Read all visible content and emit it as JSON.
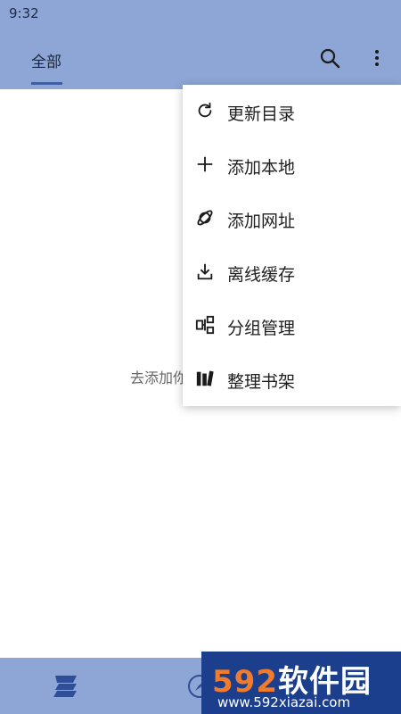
{
  "status_bar": {
    "time": "9:32"
  },
  "app_bar": {
    "tab_label": "全部",
    "search_icon": "search-icon",
    "more_icon": "more-vertical-icon"
  },
  "main": {
    "empty_hint": "去添加你"
  },
  "menu": {
    "items": [
      {
        "label": "更新目录",
        "icon": "refresh-icon"
      },
      {
        "label": "添加本地",
        "icon": "plus-icon"
      },
      {
        "label": "添加网址",
        "icon": "planet-icon"
      },
      {
        "label": "离线缓存",
        "icon": "download-icon"
      },
      {
        "label": "分组管理",
        "icon": "group-icon"
      },
      {
        "label": "整理书架",
        "icon": "bookshelf-icon"
      }
    ]
  },
  "bottom_nav": {
    "items": [
      {
        "icon": "bookshelf-brand-icon"
      },
      {
        "icon": "compass-icon"
      }
    ]
  },
  "watermark": {
    "title_number": "592",
    "title_text": "软件园",
    "url": "www.592xiazai.com"
  }
}
